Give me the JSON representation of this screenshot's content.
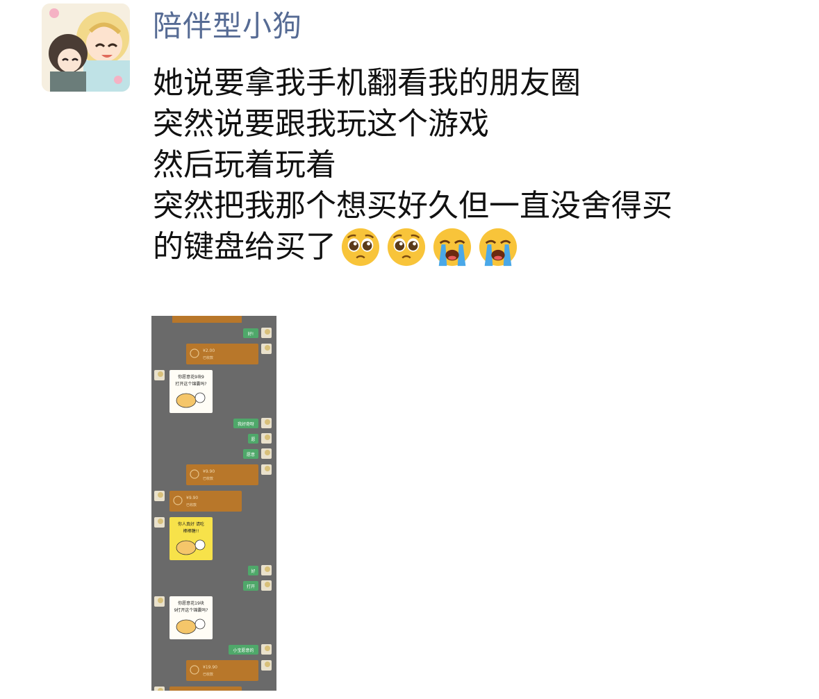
{
  "post": {
    "nickname": "陪伴型小狗",
    "lines": [
      "她说要拿我手机翻看我的朋友圈",
      "突然说要跟我玩这个游戏",
      "然后玩着玩着",
      "突然把我那个想买好久但一直没舍得买",
      "的键盘给买了"
    ],
    "emojis": [
      "pleading-face",
      "pleading-face",
      "loudly-crying-face",
      "loudly-crying-face"
    ]
  },
  "screenshot": {
    "messages": [
      {
        "side": "right",
        "type": "text",
        "text": "好!"
      },
      {
        "side": "right",
        "type": "transfer",
        "amount": "¥2.00",
        "note": "已收款"
      },
      {
        "side": "left",
        "type": "sticker",
        "text": "你愿意花9块9打开这个锦囊吗?"
      },
      {
        "side": "right",
        "type": "text",
        "text": "我好奇呀"
      },
      {
        "side": "right",
        "type": "text",
        "text": "愿"
      },
      {
        "side": "right",
        "type": "text",
        "text": "愿意"
      },
      {
        "side": "right",
        "type": "transfer",
        "amount": "¥9.90",
        "note": "已收款"
      },
      {
        "side": "left",
        "type": "transfer",
        "amount": "¥9.90",
        "note": "已收款"
      },
      {
        "side": "left",
        "type": "sticker",
        "text": "你人真好 请吃棒棒糖!!"
      },
      {
        "side": "right",
        "type": "text",
        "text": "好"
      },
      {
        "side": "right",
        "type": "text",
        "text": "打开"
      },
      {
        "side": "left",
        "type": "sticker",
        "text": "你愿意花19块9打开这个锦囊吗?"
      },
      {
        "side": "right",
        "type": "text",
        "text": "小宝愿意的"
      },
      {
        "side": "right",
        "type": "transfer",
        "amount": "¥19.90",
        "note": "已收款"
      },
      {
        "side": "left",
        "type": "transfer",
        "amount": "¥19.90",
        "note": "已收款"
      }
    ]
  },
  "colors": {
    "nickname": "#566b94",
    "chat_bg": "#6a6a6a",
    "bubble_green": "#4fa86a",
    "transfer_orange": "#b8772a"
  }
}
